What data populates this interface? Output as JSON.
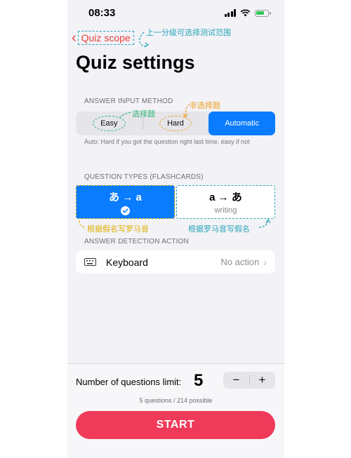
{
  "status_bar": {
    "time": "08:33"
  },
  "nav": {
    "back_label": "Quiz scope"
  },
  "title": "Quiz settings",
  "answer_input": {
    "header": "ANSWER INPUT METHOD",
    "options": [
      "Easy",
      "Hard",
      "Automatic"
    ],
    "selected": "Automatic",
    "footnote": "Auto: Hard if you got the question right last time, easy if not"
  },
  "question_types": {
    "header": "QUESTION TYPES (FLASHCARDS)",
    "cards": [
      {
        "main": "あ → a",
        "sub": "",
        "selected": true
      },
      {
        "main": "a → あ",
        "sub": "writing",
        "selected": false
      }
    ]
  },
  "detection": {
    "header": "ANSWER DETECTION ACTION",
    "row_label": "Keyboard",
    "row_value": "No action",
    "icon": "keyboard-icon"
  },
  "limit": {
    "label": "Number of questions limit:",
    "value": "5",
    "minus": "−",
    "plus": "+",
    "possible": "5 questions / 214 possible"
  },
  "start_label": "START",
  "annotations": {
    "scope": "上一分级可选择测试范围",
    "choice": "选择题",
    "non_choice": "非选择题",
    "kana_to_romaji": "根据假名写罗马音",
    "romaji_to_kana": "根据罗马音写假名"
  },
  "colors": {
    "accent_blue": "#0a7cff",
    "start_red": "#f03a5a",
    "back_red": "#e8413a",
    "note_teal": "#2aa6b8",
    "note_green": "#2bb673",
    "note_orange": "#f0a020"
  }
}
